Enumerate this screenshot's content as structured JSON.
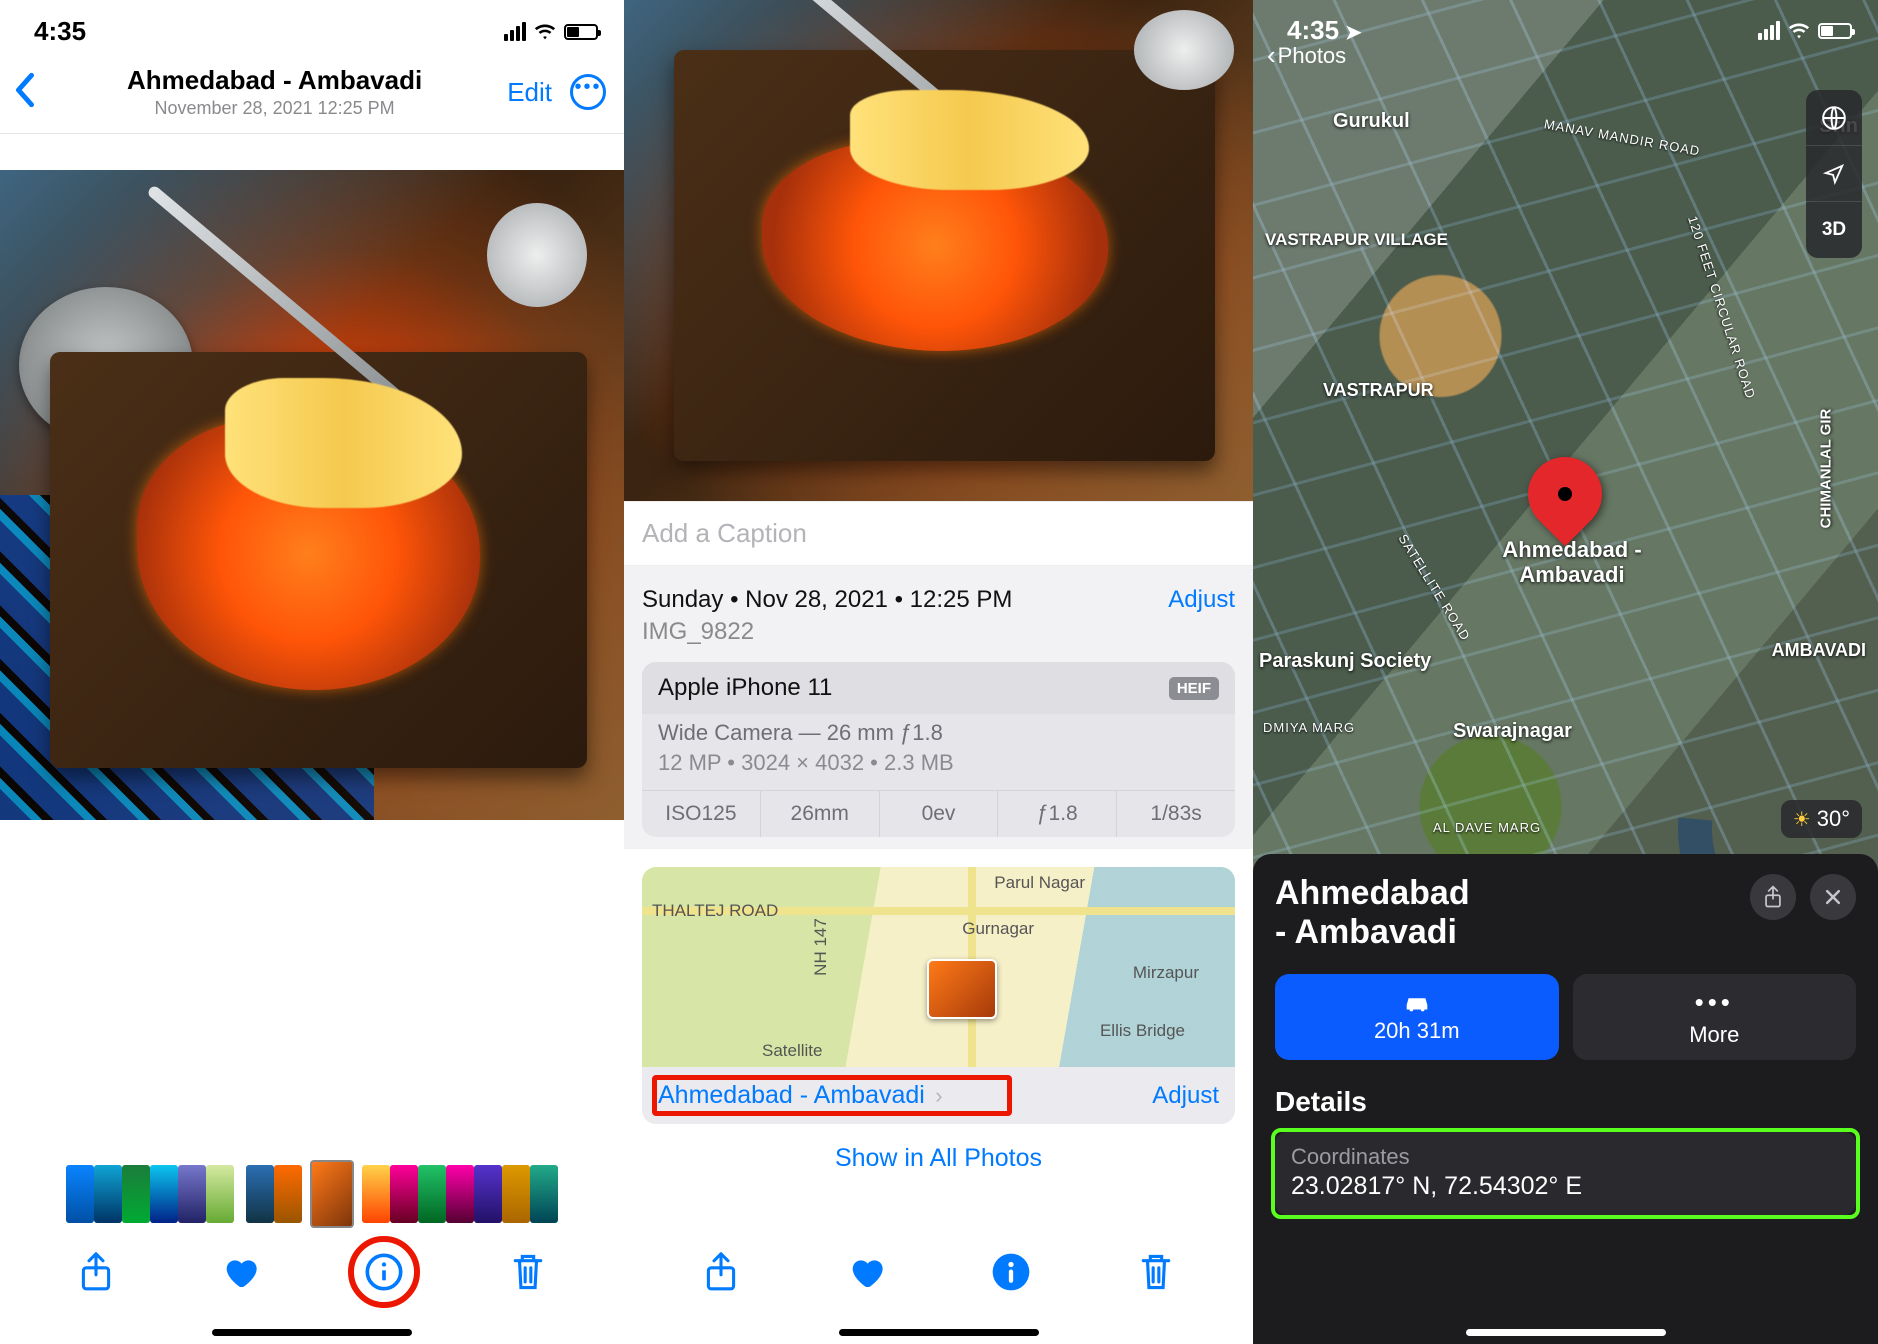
{
  "phone1": {
    "status": {
      "time": "4:35"
    },
    "header": {
      "title": "Ahmedabad - Ambavadi",
      "subtitle": "November 28, 2021  12:25 PM",
      "edit": "Edit"
    }
  },
  "phone2": {
    "caption_placeholder": "Add a Caption",
    "date_line": "Sunday • Nov 28, 2021 • 12:25 PM",
    "adjust": "Adjust",
    "filename": "IMG_9822",
    "device": {
      "name": "Apple iPhone 11",
      "format_badge": "HEIF",
      "lens": "Wide Camera — 26 mm ƒ1.8",
      "specs_line": "12 MP  •  3024 × 4032  •  2.3 MB",
      "iso": "ISO125",
      "focal": "26mm",
      "ev": "0ev",
      "aperture": "ƒ1.8",
      "shutter": "1/83s"
    },
    "mini_map": {
      "labels": [
        "THALTEJ ROAD",
        "Parul Nagar",
        "Gurnagar",
        "Mirzapur",
        "Ellis Bridge",
        "Satellite",
        "NH 147"
      ]
    },
    "location_name": "Ahmedabad - Ambavadi",
    "location_adjust": "Adjust",
    "show_all": "Show in All Photos"
  },
  "phone3": {
    "status": {
      "time": "4:35"
    },
    "back_label": "Photos",
    "pin_label_line1": "Ahmedabad -",
    "pin_label_line2": "Ambavadi",
    "controls": {
      "view_3d": "3D"
    },
    "temperature": "30°",
    "map_labels": {
      "gurukul": "Gurukul",
      "srin": "Srin",
      "vastrapur_village": "VASTRAPUR VILLAGE",
      "vastrapur": "VASTRAPUR",
      "ambavadi": "AMBAVADI",
      "paraskunj": "Paraskunj Society",
      "swarajnagar": "Swarajnagar",
      "chimanlal": "CHIMANLAL GIR",
      "road1": "MANAV MANDIR ROAD",
      "road2": "120 FEET CIRCULAR ROAD",
      "road3": "SATELLITE ROAD",
      "road4": "DMIYA MARG",
      "road5": "AL DAVE MARG"
    },
    "sheet": {
      "title_line1": "Ahmedabad",
      "title_line2": "- Ambavadi",
      "drive_time": "20h 31m",
      "more": "More",
      "details_heading": "Details",
      "coords_label": "Coordinates",
      "coords_value": "23.02817° N, 72.54302° E"
    }
  }
}
